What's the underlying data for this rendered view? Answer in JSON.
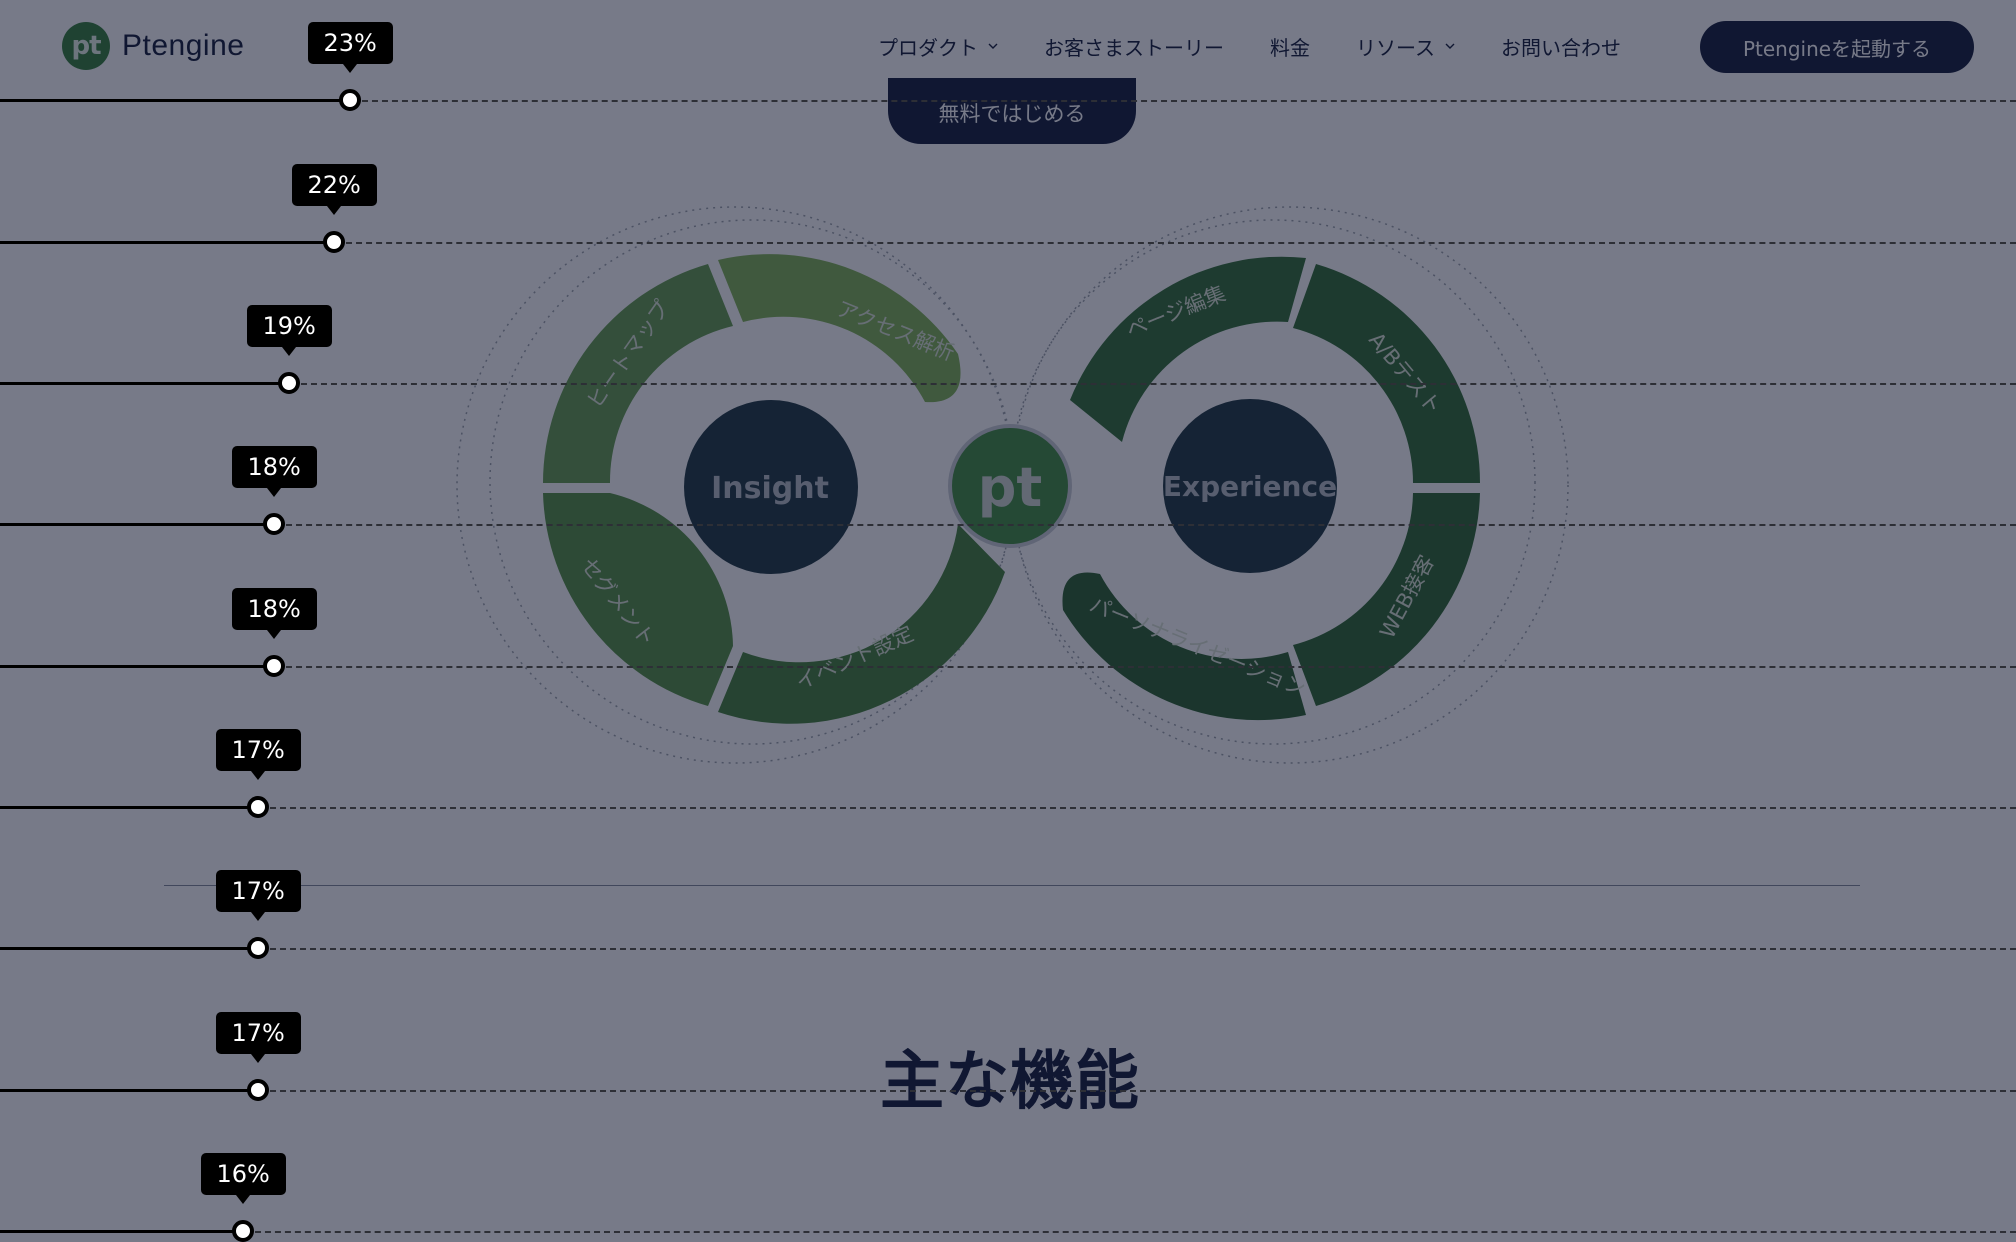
{
  "header": {
    "logo_mark": "pt",
    "logo_text": "Ptengine",
    "nav": [
      {
        "label": "プロダクト",
        "has_dropdown": true
      },
      {
        "label": "お客さまストーリー",
        "has_dropdown": false
      },
      {
        "label": "料金",
        "has_dropdown": false
      },
      {
        "label": "リソース",
        "has_dropdown": true
      },
      {
        "label": "お問い合わせ",
        "has_dropdown": false
      }
    ],
    "cta_label": "Ptengineを起動する"
  },
  "hero": {
    "free_button_label": "無料ではじめる"
  },
  "diagram": {
    "left_center_label": "Insight",
    "right_center_label": "Experience",
    "center_logo": "pt",
    "left_segments": [
      "アクセス解析",
      "ヒートマップ",
      "セグメント",
      "イベント設定"
    ],
    "right_segments": [
      "ページ編集",
      "A/Bテスト",
      "WEB接客",
      "パーソナライゼーション"
    ]
  },
  "features": {
    "title": "主な機能"
  },
  "scroll_markers": [
    {
      "label": "23%",
      "value": 23
    },
    {
      "label": "22%",
      "value": 22
    },
    {
      "label": "19%",
      "value": 19
    },
    {
      "label": "18%",
      "value": 18
    },
    {
      "label": "18%",
      "value": 18
    },
    {
      "label": "17%",
      "value": 17
    },
    {
      "label": "17%",
      "value": 17
    },
    {
      "label": "17%",
      "value": 17
    },
    {
      "label": "16%",
      "value": 16
    }
  ],
  "colors": {
    "brand_dark": "#0b1533",
    "green_light": "#6aa84f",
    "green_dark": "#2b6a2e",
    "overlay": "#141a32"
  }
}
